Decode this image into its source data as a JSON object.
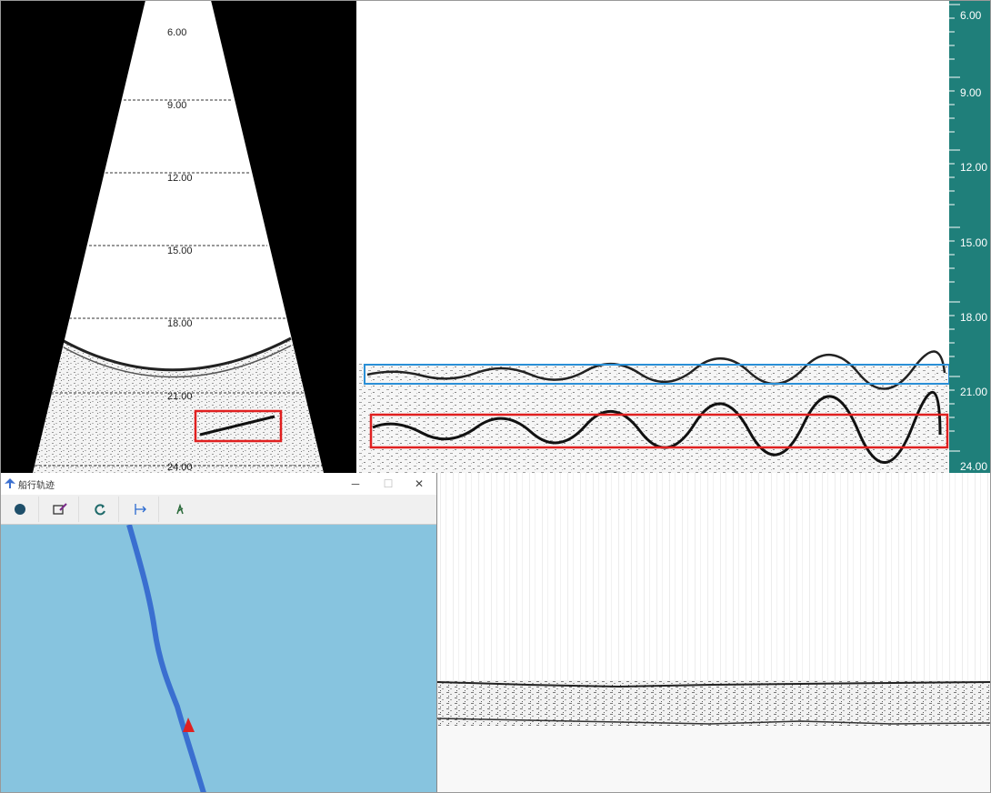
{
  "sector": {
    "depth_labels": [
      "6.00",
      "9.00",
      "12.00",
      "15.00",
      "18.00",
      "21.00",
      "24.00"
    ]
  },
  "ruler": {
    "labels": [
      "6.00",
      "9.00",
      "12.00",
      "15.00",
      "18.00",
      "21.00",
      "24.00"
    ],
    "color": "#1f7f7a"
  },
  "highlights": {
    "blue_box_color": "#2a8fd6",
    "red_box_color": "#e02020"
  },
  "track_window": {
    "title": "船行轨迹",
    "minimize": "─",
    "maximize": "☐",
    "close": "✕",
    "tools": [
      "stop-icon",
      "edit-icon",
      "refresh-icon",
      "ruler-icon",
      "location-icon"
    ],
    "map_color": "#87c4df",
    "track_color": "#3a6fd0",
    "boat_color": "#e02020"
  }
}
